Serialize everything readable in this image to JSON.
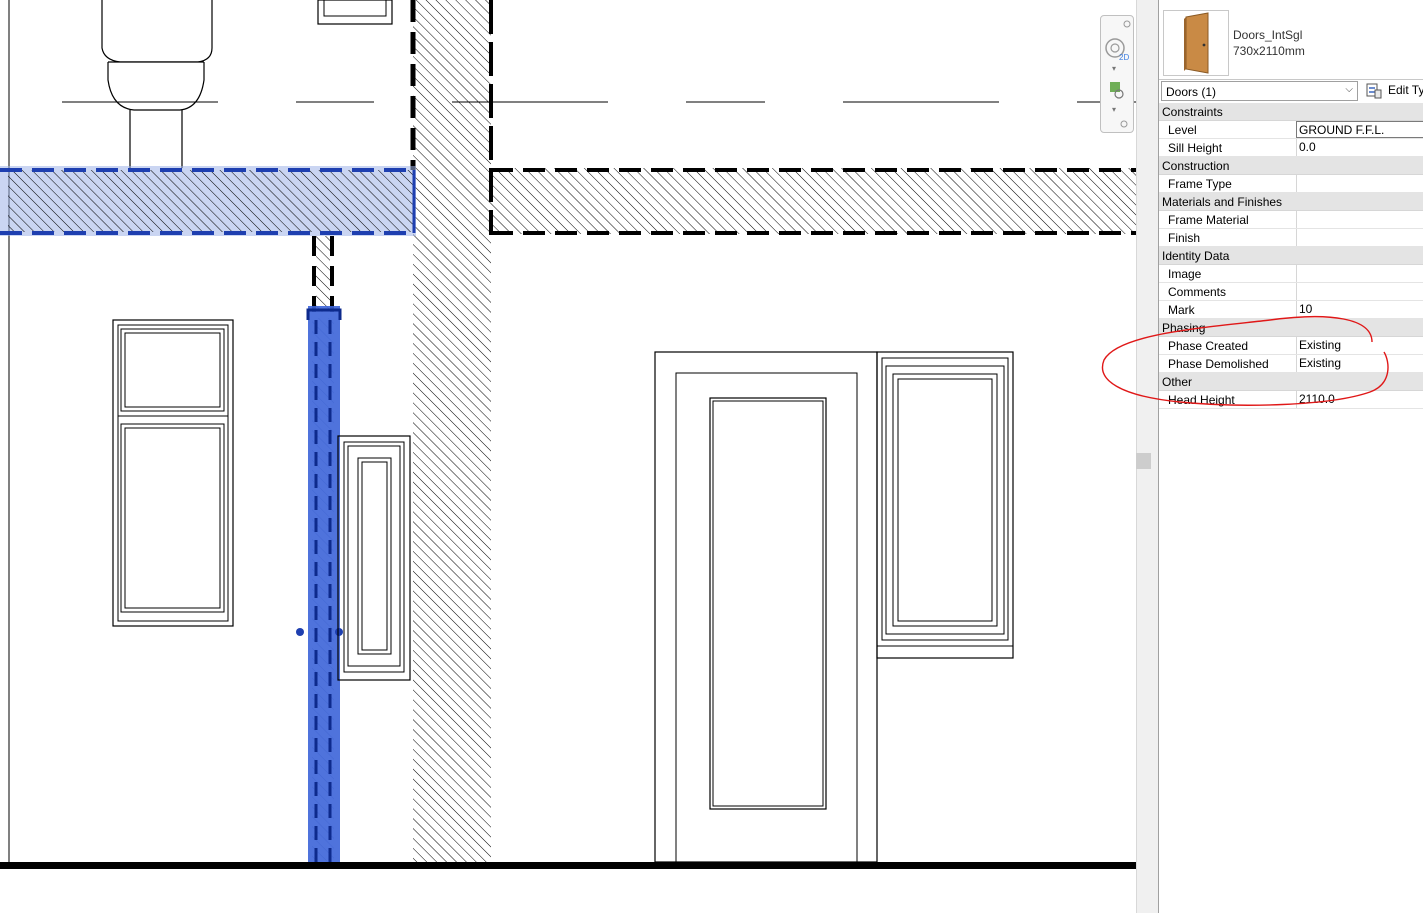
{
  "type_selector": {
    "family": "Doors_IntSgl",
    "type": "730x2110mm",
    "selection": "Doors (1)",
    "edit_type_label": "Edit Ty"
  },
  "properties": [
    {
      "group": "Constraints"
    },
    {
      "label": "Level",
      "value": "GROUND F.F.L.",
      "editing": true
    },
    {
      "label": "Sill Height",
      "value": "0.0"
    },
    {
      "group": "Construction"
    },
    {
      "label": "Frame Type",
      "value": ""
    },
    {
      "group": "Materials and Finishes"
    },
    {
      "label": "Frame Material",
      "value": ""
    },
    {
      "label": "Finish",
      "value": ""
    },
    {
      "group": "Identity Data"
    },
    {
      "label": "Image",
      "value": ""
    },
    {
      "label": "Comments",
      "value": ""
    },
    {
      "label": "Mark",
      "value": "10"
    },
    {
      "group": "Phasing"
    },
    {
      "label": "Phase Created",
      "value": "Existing"
    },
    {
      "label": "Phase Demolished",
      "value": "Existing"
    },
    {
      "group": "Other"
    },
    {
      "label": "Head Height",
      "value": "2110.0"
    }
  ],
  "colors": {
    "selection_blue": "#1e4fc8",
    "annotation_red": "#e01818"
  },
  "icons": [
    "door-thumbnail-icon",
    "edit-type-icon",
    "chevron-down-icon",
    "2d-steering-wheel-icon",
    "zoom-icon"
  ]
}
